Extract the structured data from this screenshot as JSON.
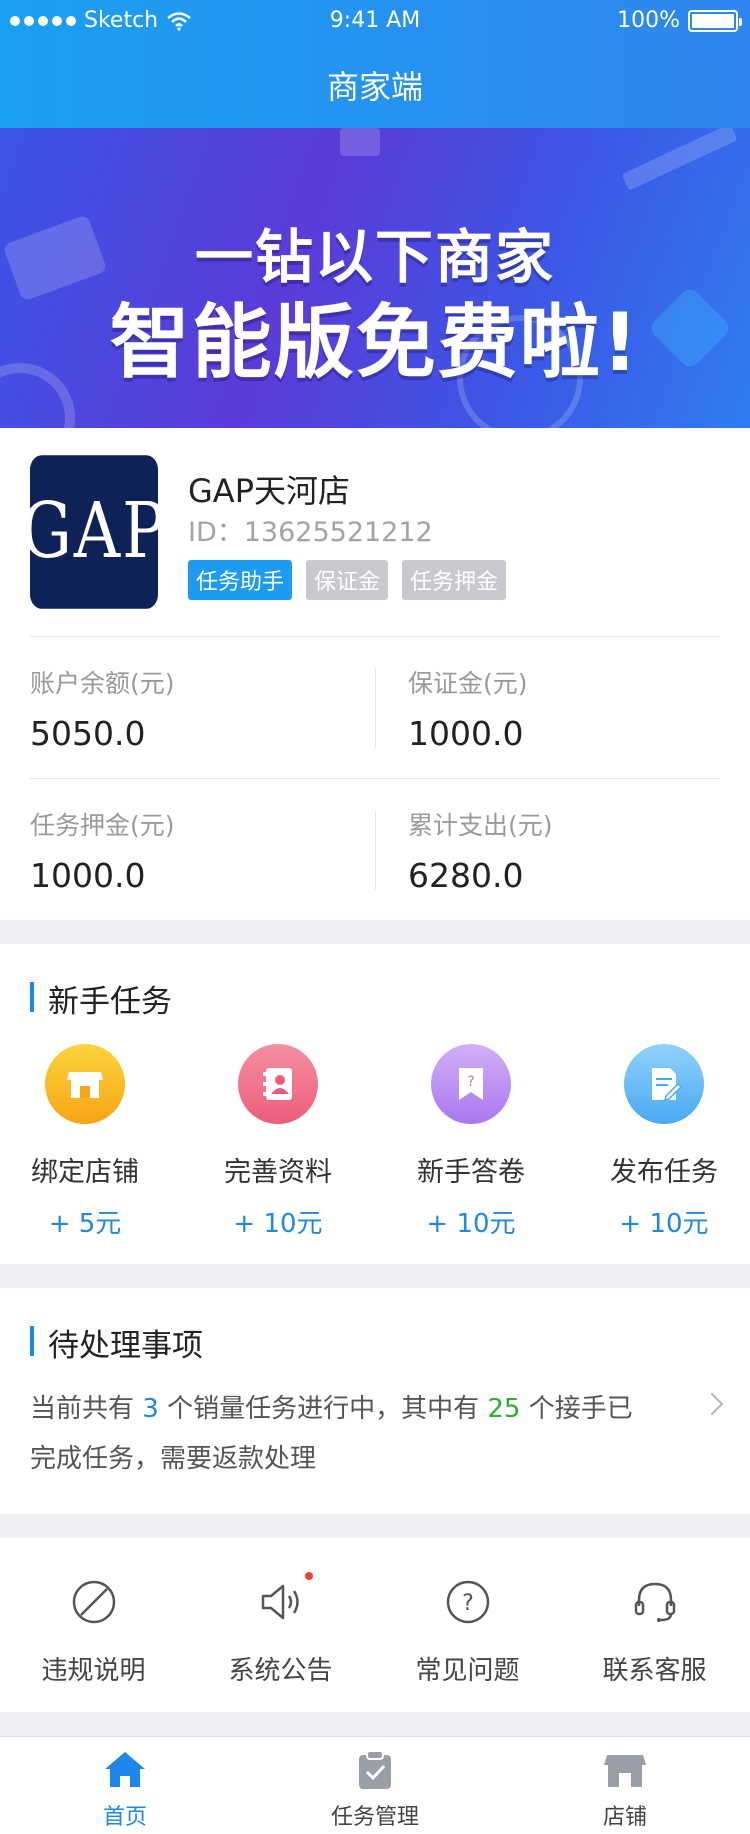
{
  "status_bar": {
    "carrier": "Sketch",
    "time": "9:41 AM",
    "battery": "100%"
  },
  "header": {
    "title": "商家端"
  },
  "banner": {
    "line1": "一钻以下商家",
    "line2": "智能版免费啦!"
  },
  "store": {
    "logo_text": "GAP",
    "name": "GAP天河店",
    "id_text": "ID：13625521212",
    "tags": [
      {
        "label": "任务助手",
        "active": true
      },
      {
        "label": "保证金",
        "active": false
      },
      {
        "label": "任务押金",
        "active": false
      }
    ],
    "stats": [
      {
        "label": "账户余额(元)",
        "value": "5050.0"
      },
      {
        "label": "保证金(元)",
        "value": "1000.0"
      },
      {
        "label": "任务押金(元)",
        "value": "1000.0"
      },
      {
        "label": "累计支出(元)",
        "value": "6280.0"
      }
    ]
  },
  "newbie": {
    "title": "新手任务",
    "items": [
      {
        "label": "绑定店铺",
        "reward": "+ 5元",
        "icon": "store-icon",
        "color": "#f8b21c"
      },
      {
        "label": "完善资料",
        "reward": "+ 10元",
        "icon": "profile-book-icon",
        "color": "#f06c87"
      },
      {
        "label": "新手答卷",
        "reward": "+ 10元",
        "icon": "question-bookmark-icon",
        "color": "#b98cf2"
      },
      {
        "label": "发布任务",
        "reward": "+ 10元",
        "icon": "document-edit-icon",
        "color": "#59b6f4"
      }
    ]
  },
  "pending": {
    "title": "待处理事项",
    "text_a": "当前共有 ",
    "count_a": "3",
    "text_b": " 个销量任务进行中，其中有 ",
    "count_b": "25",
    "text_c": " 个接手已完成任务，需要返款处理"
  },
  "quick": [
    {
      "label": "违规说明",
      "icon": "forbidden-icon"
    },
    {
      "label": "系统公告",
      "icon": "speaker-icon"
    },
    {
      "label": "常见问题",
      "icon": "question-circle-icon"
    },
    {
      "label": "联系客服",
      "icon": "headset-icon"
    }
  ],
  "tabbar": [
    {
      "label": "首页",
      "icon": "home-icon",
      "active": true
    },
    {
      "label": "任务管理",
      "icon": "clipboard-icon",
      "active": false
    },
    {
      "label": "店铺",
      "icon": "shop-icon",
      "active": false
    }
  ],
  "colors": {
    "accent": "#1d87ea",
    "header_start": "#1aa0f2",
    "header_end": "#2f86ee",
    "green": "#29b12f"
  }
}
